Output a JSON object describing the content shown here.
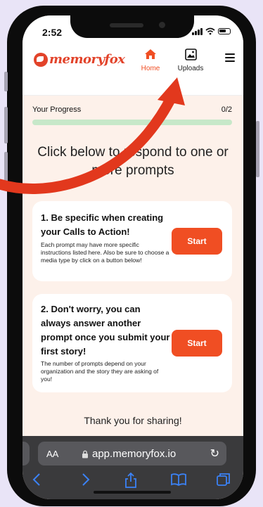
{
  "status": {
    "time": "2:52"
  },
  "header": {
    "logo_text": "memoryfox",
    "nav": [
      {
        "label": "Home",
        "icon": "home-icon",
        "active": true
      },
      {
        "label": "Uploads",
        "icon": "image-icon",
        "active": false
      }
    ],
    "menu_icon": "hamburger-icon"
  },
  "progress": {
    "label": "Your Progress",
    "count": "0/2",
    "completed": 0,
    "total": 2
  },
  "main": {
    "title": "Click below to respond to one or more prompts",
    "prompts": [
      {
        "title": "1. Be specific when creating your Calls to Action!",
        "description": "Each prompt may have more specific instructions listed here. Also be sure to choose a media type by click on a button below!",
        "button": "Start"
      },
      {
        "title": "2. Don't worry, you can always answer another prompt once you submit your first story!",
        "description": "The number of prompts depend on your organization and the story they are asking of you!",
        "button": "Start"
      }
    ],
    "footer": "Thank you for sharing!"
  },
  "browser": {
    "aa": "AA",
    "url": "app.memoryfox.io",
    "toolbar": [
      "back-icon",
      "forward-icon",
      "share-icon",
      "bookmarks-icon",
      "tabs-icon"
    ]
  },
  "colors": {
    "accent": "#f04e23",
    "background": "#fdf1ea",
    "progress_track": "#c7e8c9",
    "page_bg": "#e9e4f7",
    "browser_bar": "#3a3a3c",
    "link_blue": "#3b82f6",
    "arrow": "#e2381d"
  }
}
